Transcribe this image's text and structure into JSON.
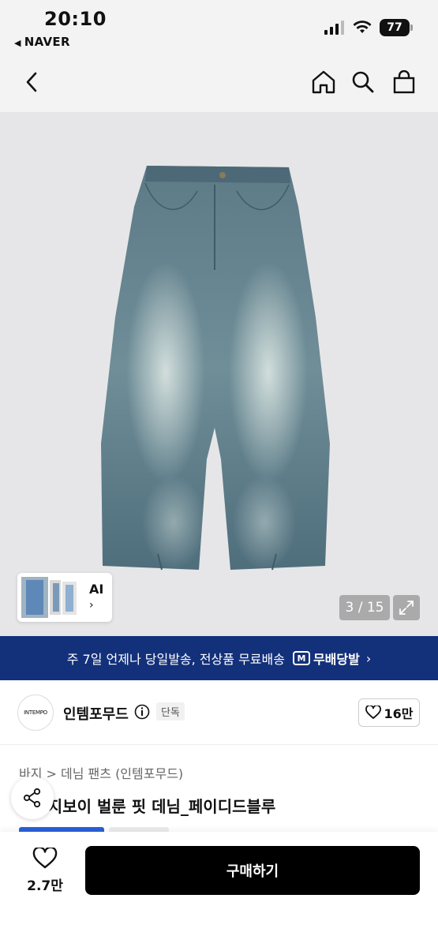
{
  "status_bar": {
    "time": "20:10",
    "back_app": "NAVER",
    "battery": "77"
  },
  "nav": {
    "icons": [
      "back-icon",
      "home-icon",
      "search-icon",
      "shopping-bag-icon"
    ]
  },
  "gallery": {
    "counter": "3 / 15",
    "ai_label": "AI",
    "ai_chevron": "›"
  },
  "shipping_banner": {
    "text": "주 7일 언제나 당일발송, 전상품 무료배송",
    "badge": "무배당발",
    "badge_icon": "M",
    "chevron": "›"
  },
  "store": {
    "logo_text": "INTEMPO",
    "name": "인템포무드",
    "exclusive_tag": "단독",
    "likes": "16만"
  },
  "product": {
    "breadcrumb": "바지 > 데님 팬츠 (인템포무드)",
    "title": "레이지보이 벌룬 핏 데님_페이디드블루"
  },
  "bottom_bar": {
    "wish_count": "2.7만",
    "buy_label": "구매하기"
  },
  "colors": {
    "banner_blue": "#13307a",
    "buy_black": "#000000",
    "hero_bg": "#e6e6e8"
  }
}
